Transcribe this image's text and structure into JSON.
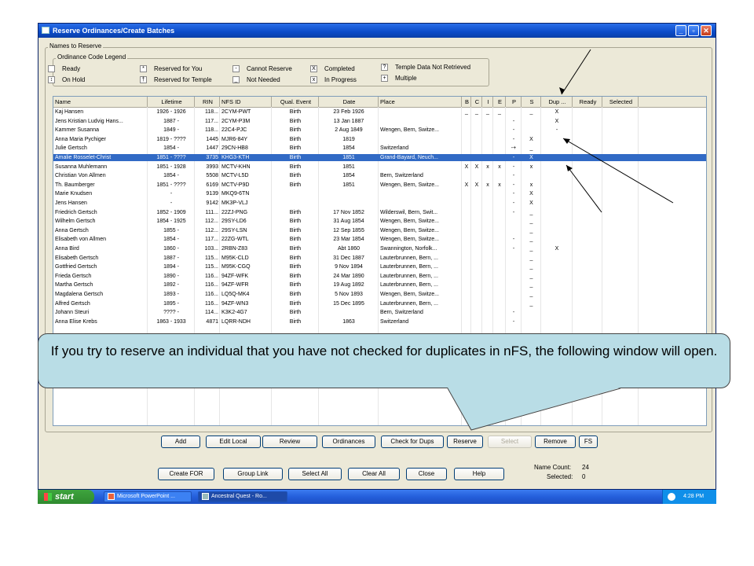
{
  "window": {
    "title": "Reserve Ordinances/Create Batches"
  },
  "names_group_label": "Names to Reserve",
  "legend": {
    "title": "Ordinance Code Legend",
    "items": [
      {
        "symbol": "",
        "label": "Ready"
      },
      {
        "symbol": "*",
        "label": "Reserved for You"
      },
      {
        "symbol": "-",
        "label": "Cannot Reserve"
      },
      {
        "symbol": "X",
        "label": "Completed"
      },
      {
        "symbol": "?",
        "label": "Temple Data Not Retrieved"
      },
      {
        "symbol": "↕",
        "label": "On Hold"
      },
      {
        "symbol": "†",
        "label": "Reserved for Temple"
      },
      {
        "symbol": "_",
        "label": "Not Needed"
      },
      {
        "symbol": "x",
        "label": "In Progress"
      },
      {
        "symbol": "+",
        "label": "Multiple"
      }
    ]
  },
  "columns": [
    "Name",
    "Lifetime",
    "RIN",
    "NFS ID",
    "Qual. Event",
    "Date",
    "Place",
    "B",
    "C",
    "I",
    "E",
    "P",
    "S",
    "Dup ...",
    "Ready",
    "Selected"
  ],
  "rows": [
    {
      "name": "Kaj Hansen",
      "lifetime": "1926 - 1926",
      "rin": "118...",
      "nfs": "2CYM-PWT",
      "qual": "Birth",
      "date": "23 Feb 1926",
      "place": "",
      "b": "_",
      "c": "_",
      "i": "_",
      "e": "_",
      "p": "",
      "s": "_",
      "dup": "X"
    },
    {
      "name": "Jens Kristian Ludvig Hans...",
      "lifetime": "1887 -",
      "rin": "117...",
      "nfs": "2CYM-P3M",
      "qual": "Birth",
      "date": "13 Jan 1887",
      "place": "",
      "b": "",
      "c": "",
      "i": "",
      "e": "",
      "p": "-",
      "s": "",
      "dup": "X"
    },
    {
      "name": "Kammer Susanna",
      "lifetime": "1849 -",
      "rin": "118...",
      "nfs": "22C4-PJC",
      "qual": "Birth",
      "date": "2 Aug 1849",
      "place": "Wengen, Bern, Switze...",
      "b": "",
      "c": "",
      "i": "",
      "e": "",
      "p": "-",
      "s": "",
      "dup": "-"
    },
    {
      "name": "Anna Maria Pychiger",
      "lifetime": "1819 - ????",
      "rin": "1445",
      "nfs": "MJR6-84Y",
      "qual": "Birth",
      "date": "1819",
      "place": "",
      "b": "",
      "c": "",
      "i": "",
      "e": "",
      "p": "-",
      "s": "X",
      "dup": ""
    },
    {
      "name": "Julie Gertsch",
      "lifetime": "1854 -",
      "rin": "1447",
      "nfs": "29CN-HB8",
      "qual": "Birth",
      "date": "1854",
      "place": "Switzerland",
      "b": "",
      "c": "",
      "i": "",
      "e": "",
      "p": "-+",
      "s": "_",
      "dup": ""
    },
    {
      "name": "Amalie Rosselet-Christ",
      "lifetime": "1851 - ????",
      "rin": "3735",
      "nfs": "KHG3-KTH",
      "qual": "Birth",
      "date": "1851",
      "place": "Grand-Bayard, Neuch...",
      "b": "",
      "c": "",
      "i": "",
      "e": "",
      "p": "-",
      "s": "X",
      "dup": "",
      "selected_row": true
    },
    {
      "name": "Susanna Muhlemann",
      "lifetime": "1851 - 1928",
      "rin": "3993",
      "nfs": "MCTV-KHN",
      "qual": "Birth",
      "date": "1851",
      "place": "",
      "b": "X",
      "c": "X",
      "i": "x",
      "e": "x",
      "p": "-",
      "s": "x",
      "dup": ""
    },
    {
      "name": "Christian Von Allmen",
      "lifetime": "1854 -",
      "rin": "5508",
      "nfs": "MCTV-L5D",
      "qual": "Birth",
      "date": "1854",
      "place": "Bern, Switzerland",
      "b": "",
      "c": "",
      "i": "",
      "e": "",
      "p": "-",
      "s": "",
      "dup": ""
    },
    {
      "name": "Th. Baumberger",
      "lifetime": "1851 - ????",
      "rin": "6169",
      "nfs": "MCTV-P9D",
      "qual": "Birth",
      "date": "1851",
      "place": "Wengen, Bern, Switze...",
      "b": "X",
      "c": "X",
      "i": "x",
      "e": "x",
      "p": "-",
      "s": "x",
      "dup": ""
    },
    {
      "name": "Marie Knudsen",
      "lifetime": "-",
      "rin": "9139",
      "nfs": "MKQ9-6TN",
      "qual": "",
      "date": "",
      "place": "",
      "b": "",
      "c": "",
      "i": "",
      "e": "",
      "p": "-",
      "s": "X",
      "dup": ""
    },
    {
      "name": "Jens Hansen",
      "lifetime": "-",
      "rin": "9142",
      "nfs": "MK3P-VLJ",
      "qual": "",
      "date": "",
      "place": "",
      "b": "",
      "c": "",
      "i": "",
      "e": "",
      "p": "-",
      "s": "X",
      "dup": ""
    },
    {
      "name": "Friedrich Gertsch",
      "lifetime": "1852 - 1909",
      "rin": "111...",
      "nfs": "22ZJ-PNG",
      "qual": "Birth",
      "date": "17 Nov 1852",
      "place": "Wilderswil, Bern, Swit...",
      "b": "",
      "c": "",
      "i": "",
      "e": "",
      "p": "-",
      "s": "_",
      "dup": ""
    },
    {
      "name": "Wilhelm Gertsch",
      "lifetime": "1854 - 1925",
      "rin": "112...",
      "nfs": "29SY-LD6",
      "qual": "Birth",
      "date": "31 Aug 1854",
      "place": "Wengen, Bern, Switze...",
      "b": "",
      "c": "",
      "i": "",
      "e": "",
      "p": "",
      "s": "_",
      "dup": ""
    },
    {
      "name": "Anna Gertsch",
      "lifetime": "1855 -",
      "rin": "112...",
      "nfs": "29SY-LSN",
      "qual": "Birth",
      "date": "12 Sep 1855",
      "place": "Wengen, Bern, Switze...",
      "b": "",
      "c": "",
      "i": "",
      "e": "",
      "p": "",
      "s": "_",
      "dup": ""
    },
    {
      "name": "Elisabeth von Allmen",
      "lifetime": "1854 -",
      "rin": "117...",
      "nfs": "22ZG-WTL",
      "qual": "Birth",
      "date": "23 Mar 1854",
      "place": "Wengen, Bern, Switze...",
      "b": "",
      "c": "",
      "i": "",
      "e": "",
      "p": "-",
      "s": "_",
      "dup": ""
    },
    {
      "name": "Anna Bird",
      "lifetime": "1860 -",
      "rin": "103...",
      "nfs": "2RBN-Z83",
      "qual": "Birth",
      "date": "Abt 1860",
      "place": "Swannington, Norfolk...",
      "b": "",
      "c": "",
      "i": "",
      "e": "",
      "p": "-",
      "s": "_",
      "dup": "X"
    },
    {
      "name": "Elisabeth Gertsch",
      "lifetime": "1887 -",
      "rin": "115...",
      "nfs": "M95K-CLD",
      "qual": "Birth",
      "date": "31 Dec 1887",
      "place": "Lauterbrunnen, Bern, ...",
      "b": "",
      "c": "",
      "i": "",
      "e": "",
      "p": "",
      "s": "_",
      "dup": ""
    },
    {
      "name": "Gottfried Gertsch",
      "lifetime": "1894 -",
      "rin": "115...",
      "nfs": "M95K-CGQ",
      "qual": "Birth",
      "date": "9 Nov 1894",
      "place": "Lauterbrunnen, Bern, ...",
      "b": "",
      "c": "",
      "i": "",
      "e": "",
      "p": "",
      "s": "_",
      "dup": ""
    },
    {
      "name": "Frieda Gertsch",
      "lifetime": "1890 -",
      "rin": "116...",
      "nfs": "94ZF-WFK",
      "qual": "Birth",
      "date": "24 Mar 1890",
      "place": "Lauterbrunnen, Bern, ...",
      "b": "",
      "c": "",
      "i": "",
      "e": "",
      "p": "",
      "s": "_",
      "dup": ""
    },
    {
      "name": "Martha Gertsch",
      "lifetime": "1892 -",
      "rin": "116...",
      "nfs": "94ZF-WFR",
      "qual": "Birth",
      "date": "19 Aug 1892",
      "place": "Lauterbrunnen, Bern, ...",
      "b": "",
      "c": "",
      "i": "",
      "e": "",
      "p": "",
      "s": "_",
      "dup": ""
    },
    {
      "name": "Magdalena Gertsch",
      "lifetime": "1893 -",
      "rin": "116...",
      "nfs": "LQ5Q-MK4",
      "qual": "Birth",
      "date": "5 Nov 1893",
      "place": "Wengen, Bern, Switze...",
      "b": "",
      "c": "",
      "i": "",
      "e": "",
      "p": "",
      "s": "_",
      "dup": ""
    },
    {
      "name": "Alfred Gertsch",
      "lifetime": "1895 -",
      "rin": "116...",
      "nfs": "94ZF-WN3",
      "qual": "Birth",
      "date": "15 Dec 1895",
      "place": "Lauterbrunnen, Bern, ...",
      "b": "",
      "c": "",
      "i": "",
      "e": "",
      "p": "",
      "s": "_",
      "dup": ""
    },
    {
      "name": "Johann Steuri",
      "lifetime": "???? -",
      "rin": "114...",
      "nfs": "K3K2-4G7",
      "qual": "Birth",
      "date": "",
      "place": "Bern, Switzerland",
      "b": "",
      "c": "",
      "i": "",
      "e": "",
      "p": "-",
      "s": "",
      "dup": ""
    },
    {
      "name": "Anna Elise Krebs",
      "lifetime": "1863 - 1933",
      "rin": "4871",
      "nfs": "LQRR-NDH",
      "qual": "Birth",
      "date": "1863",
      "place": "Switzerland",
      "b": "",
      "c": "",
      "i": "",
      "e": "",
      "p": "-",
      "s": "",
      "dup": ""
    }
  ],
  "action_buttons": [
    "Add",
    "Edit Local",
    "Review",
    "Ordinances",
    "Check for Dups",
    "Reserve",
    "Select",
    "Remove",
    "FS"
  ],
  "bottom_buttons": [
    "Create FOR",
    "Group Link",
    "Select All",
    "Clear All",
    "Close",
    "Help"
  ],
  "counts": {
    "name_count_label": "Name Count:",
    "name_count": "24",
    "selected_label": "Selected:",
    "selected": "0"
  },
  "taskbar": {
    "start": "start",
    "tasks": [
      "Microsoft PowerPoint ...",
      "Ancestral Quest - Ro..."
    ],
    "clock": "4:28 PM"
  },
  "callout": "If you try to reserve an individual that you have not checked for duplicates in nFS, the following window will open."
}
